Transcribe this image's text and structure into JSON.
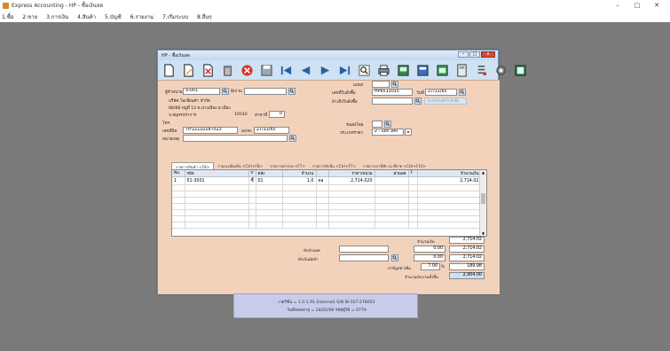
{
  "app": {
    "title": "Express Accounting - HP - ซื้อเงินสด",
    "controls": [
      "–",
      "□",
      "✕"
    ]
  },
  "menu": [
    "1.ซื้อ",
    "2.ขาย",
    "3.การเงิน",
    "4.สินค้า",
    "5.บัญชี",
    "6.รายงาน",
    "7.เริ่มระบบ",
    "8.อื่นๆ"
  ],
  "window": {
    "title": "HP - ซื้อเงินสด",
    "controls": [
      "–",
      "□",
      "x"
    ]
  },
  "toolbar": [
    "new-icon",
    "edit-icon",
    "delete-icon",
    "trash-icon",
    "cancel-icon",
    "save-icon",
    "first-icon",
    "prev-icon",
    "next-icon",
    "last-icon",
    "search-icon",
    "print-icon",
    "preview-icon",
    "export-icon",
    "attach-icon",
    "calc-icon",
    "list-icon",
    "tools-icon",
    "report-icon"
  ],
  "form": {
    "supplier_label": "ผู้จำหน่าย",
    "supplier_code": "V-001",
    "billto_label": "Bill to",
    "supplier_name": "บริษัท โอเชี่ยนค้า จำกัด",
    "address1": "88/88 หมู่ที่ 12 ต.บางเมือง อ.เมือง",
    "address2": "จ.สมุทรปราการ",
    "postcode": "10540",
    "branch_label": "สาขาที่",
    "branch_value": "0",
    "tel_label": "โทร.",
    "taxid_label": "เลขที่บิล",
    "taxid_value": "TIF22110287023",
    "billdate_label": "ลงวท.",
    "billdate_value": "27/11/65",
    "remark_label": "หมายเหตุ",
    "dept_label": "แผนก",
    "docno_label": "เลขที่ใบสั่งซื้อ",
    "docno_value": "HP6511015",
    "date_label": "วันที่",
    "date_value": "27/11/65",
    "date_hint": "ช่วงวันบันทึกใบสั่งซื้อ",
    "po_label": "อ้างถึงใบสั่งซื้อ",
    "job_label": "ชนส่งโดย",
    "vat_label": "ประเภทราคา",
    "vat_value": "2 - แยก VAT"
  },
  "tabs": [
    "รายการสินค้า <F8>",
    "รายละเอียดอื่น <Ctrl+F8>",
    "รายการค่าจ่าย <F7>",
    "รายการหักอื่น <Ctrl+F7>",
    "รายการภาษีหัก ณ ที่จ่าย <Ctrl+F10>"
  ],
  "grid": {
    "headers": [
      "No.",
      "รหัส",
      "V",
      "คลัง",
      "จำนวน",
      "",
      "ราคา/หน่วย",
      "ส่วนลด",
      "F",
      "จำนวนเงิน"
    ],
    "rows": [
      [
        "1",
        "51-3001",
        "ซื้",
        "01",
        "1.0",
        "ea",
        "2,714.020",
        "",
        "",
        "2,714.02"
      ]
    ]
  },
  "summary": {
    "total_label": "จำนวนเงิน",
    "total": "2,714.02",
    "discount_label": "หักส่วนลด",
    "discount": "0.00",
    "after_discount": "2,714.02",
    "deposit_label": "หักเงินมัดจำ",
    "deposit": "0.00",
    "net_before_vat": "2,714.02",
    "vat_label": "ภาษีมูลค่าเพิ่ม",
    "vat_rate": "7.00",
    "vat_pct": "%",
    "vat": "189.98",
    "grand_label": "จำนวนเงินรวมทั้งสิ้น",
    "grand": "2,904.00"
  },
  "footer": {
    "line1": "เวอร์ชั่น = 1.0.1.91 (Internal)     S/N W-107-278653",
    "line2": "วันที่หมดอายุ = 24/02/66     รหัสผู้ใช้ = 0779"
  }
}
